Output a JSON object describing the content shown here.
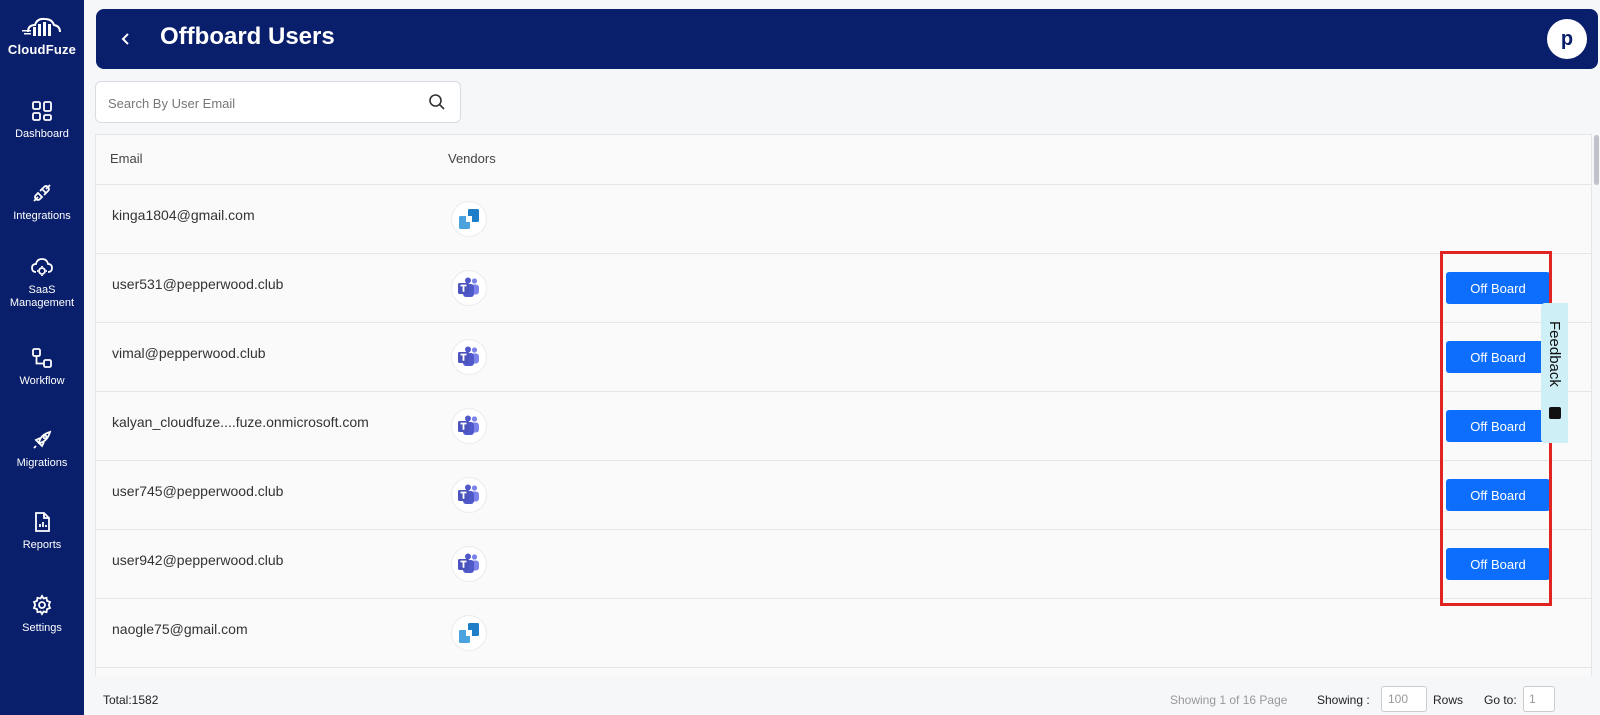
{
  "brand": {
    "name": "CloudFuze"
  },
  "sidebar": {
    "items": [
      {
        "label": "Dashboard",
        "icon": "dashboard-icon"
      },
      {
        "label": "Integrations",
        "icon": "plug-icon"
      },
      {
        "label": "SaaS Management",
        "icon": "cloud-gear-icon"
      },
      {
        "label": "Workflow",
        "icon": "workflow-icon"
      },
      {
        "label": "Migrations",
        "icon": "rocket-icon"
      },
      {
        "label": "Reports",
        "icon": "report-icon"
      },
      {
        "label": "Settings",
        "icon": "gear-icon"
      }
    ]
  },
  "header": {
    "title": "Offboard Users",
    "avatar_letter": "p"
  },
  "search": {
    "placeholder": "Search By User Email",
    "value": ""
  },
  "table": {
    "columns": [
      "Email",
      "Vendors"
    ],
    "rows": [
      {
        "email": "kinga1804@gmail.com",
        "vendor": "Dropbox",
        "offboard": false
      },
      {
        "email": "user531@pepperwood.club",
        "vendor": "Microsoft Teams",
        "offboard": true
      },
      {
        "email": "vimal@pepperwood.club",
        "vendor": "Microsoft Teams",
        "offboard": true
      },
      {
        "email": "kalyan_cloudfuze....fuze.onmicrosoft.com",
        "vendor": "Microsoft Teams",
        "offboard": true
      },
      {
        "email": "user745@pepperwood.club",
        "vendor": "Microsoft Teams",
        "offboard": true
      },
      {
        "email": "user942@pepperwood.club",
        "vendor": "Microsoft Teams",
        "offboard": true
      },
      {
        "email": "naogle75@gmail.com",
        "vendor": "Dropbox",
        "offboard": false
      }
    ],
    "action_label": "Off Board"
  },
  "feedback": {
    "label": "Feedback"
  },
  "footer": {
    "total": "Total:1582",
    "showing_page": "Showing 1 of 16 Page",
    "showing_label": "Showing :",
    "rows_value": "100",
    "rows_label": "Rows",
    "goto_label": "Go to:",
    "goto_value": "1"
  },
  "colors": {
    "navy": "#0a1f6b",
    "button_blue": "#0d6efd",
    "highlight_red": "#e02424",
    "feedback_bg": "#cdeff5"
  }
}
